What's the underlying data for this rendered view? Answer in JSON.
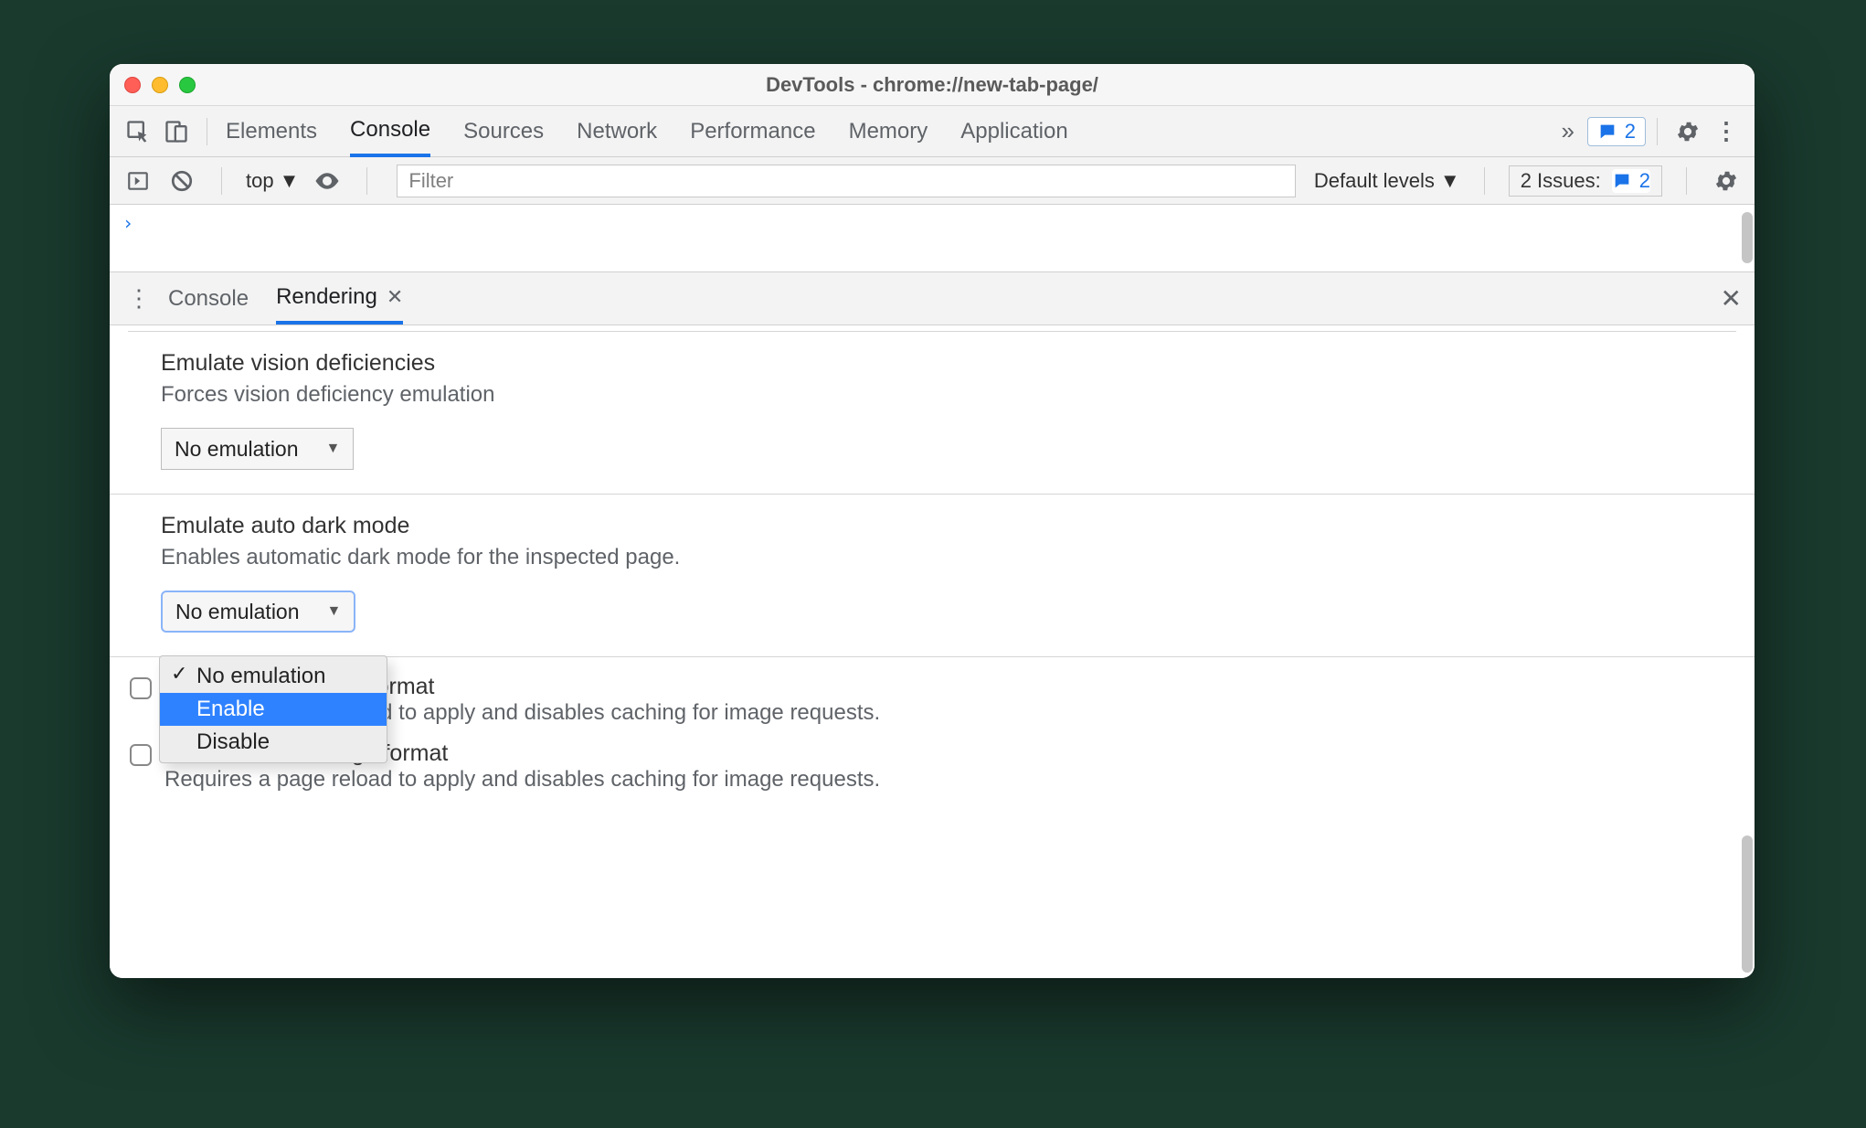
{
  "window": {
    "title": "DevTools - chrome://new-tab-page/"
  },
  "tabs": {
    "items": [
      "Elements",
      "Console",
      "Sources",
      "Network",
      "Performance",
      "Memory",
      "Application"
    ],
    "overflow_glyph": "»",
    "active": "Console",
    "messages_count": "2"
  },
  "console_bar": {
    "context": "top",
    "filter_placeholder": "Filter",
    "levels": "Default levels",
    "issues_label": "2 Issues:",
    "issues_count": "2"
  },
  "console_output": {
    "prompt": "›"
  },
  "drawer": {
    "tabs": [
      "Console",
      "Rendering"
    ],
    "active": "Rendering",
    "sections": {
      "vision": {
        "title": "Emulate vision deficiencies",
        "desc": "Forces vision deficiency emulation",
        "value": "No emulation"
      },
      "darkmode": {
        "title": "Emulate auto dark mode",
        "desc": "Enables automatic dark mode for the inspected page.",
        "value": "No emulation",
        "options": [
          "No emulation",
          "Enable",
          "Disable"
        ],
        "highlighted": "Enable"
      },
      "avif": {
        "title": "Disable AVIF image format",
        "title_visible_tail": "format",
        "desc_visible_tail": "oad to apply and disables caching for image requests."
      },
      "webp": {
        "title": "Disable WebP image format",
        "desc": "Requires a page reload to apply and disables caching for image requests."
      }
    }
  }
}
